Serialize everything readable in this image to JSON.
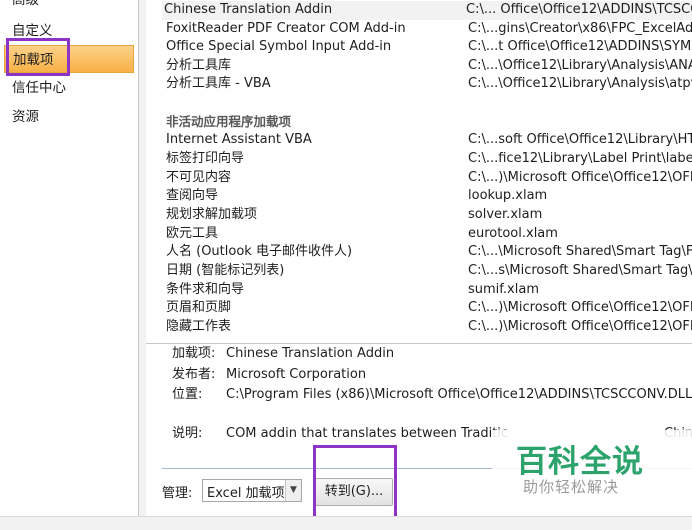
{
  "sidebar": {
    "items": [
      {
        "label": "高级"
      },
      {
        "label": "自定义"
      },
      {
        "label": "加载项"
      },
      {
        "label": "信任中心"
      },
      {
        "label": "资源"
      }
    ]
  },
  "addins": {
    "active_rows": [
      {
        "name": "Chinese Translation Addin",
        "location": "C:\\... Office\\Office12\\ADDINS\\TCSCC"
      },
      {
        "name": "FoxitReader PDF Creator COM Add-in",
        "location": "C:\\...gins\\Creator\\x86\\FPC_ExcelAddi"
      },
      {
        "name": "Office Special Symbol Input Add-in",
        "location": "C:\\...t Office\\Office12\\ADDINS\\SYMIN"
      },
      {
        "name": "分析工具库",
        "location": "C:\\...\\Office12\\Library\\Analysis\\ANAL"
      },
      {
        "name": "分析工具库 - VBA",
        "location": "C:\\...\\Office12\\Library\\Analysis\\atpvb"
      }
    ],
    "inactive_header": "非活动应用程序加载项",
    "inactive_rows": [
      {
        "name": "Internet Assistant VBA",
        "location": "C:\\...soft Office\\Office12\\Library\\HTM"
      },
      {
        "name": "标签打印向导",
        "location": "C:\\...fice12\\Library\\Label Print\\labelp"
      },
      {
        "name": "不可见内容",
        "location": "C:\\...)\\Microsoft Office\\Office12\\OFF"
      },
      {
        "name": "查阅向导",
        "location": "lookup.xlam"
      },
      {
        "name": "规划求解加载项",
        "location": "solver.xlam"
      },
      {
        "name": "欧元工具",
        "location": "eurotool.xlam"
      },
      {
        "name": "人名 (Outlook 电子邮件收件人)",
        "location": "C:\\...\\Microsoft Shared\\Smart Tag\\FN"
      },
      {
        "name": "日期 (智能标记列表)",
        "location": "C:\\...s\\Microsoft Shared\\Smart Tag\\M"
      },
      {
        "name": "条件求和向导",
        "location": "sumif.xlam"
      },
      {
        "name": "页眉和页脚",
        "location": "C:\\...)\\Microsoft Office\\Office12\\OFF"
      },
      {
        "name": "隐藏工作表",
        "location": "C:\\...)\\Microsoft Office\\Office12\\OFF"
      }
    ]
  },
  "details": {
    "addin_label": "加载项:",
    "addin_value": "Chinese Translation Addin",
    "publisher_label": "发布者:",
    "publisher_value": "Microsoft Corporation",
    "location_label": "位置:",
    "location_value": "C:\\Program Files (x86)\\Microsoft Office\\Office12\\ADDINS\\TCSCCONV.DLL",
    "description_label": "说明:",
    "description_value": "COM addin that translates between Traditic",
    "description_tail": "Chin"
  },
  "manage": {
    "label": "管理:",
    "selected": "Excel 加载项",
    "go_label": "转到(G)..."
  },
  "watermark": {
    "title": "百科全说",
    "subtitle": "助你轻松解决"
  },
  "colors": {
    "highlight": "#8e34c4",
    "active_nav": "#f8b046",
    "watermark_green": "#2ba36b"
  }
}
